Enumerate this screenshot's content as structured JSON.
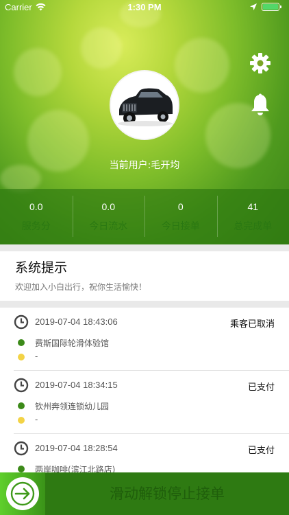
{
  "status_bar": {
    "carrier": "Carrier",
    "time": "1:30 PM"
  },
  "header": {
    "avatar_icon": "car-photo",
    "username": "当前用户:毛开均",
    "settings_icon": "gear-icon",
    "notifications_icon": "bell-icon"
  },
  "stats": [
    {
      "value": "0.0",
      "label": "服务分"
    },
    {
      "value": "0.0",
      "label": "今日流水"
    },
    {
      "value": "0",
      "label": "今日接单"
    },
    {
      "value": "41",
      "label": "总完成单"
    }
  ],
  "notice": {
    "title": "系统提示",
    "message": "欢迎加入小白出行，祝你生活愉快！"
  },
  "orders": [
    {
      "time": "2019-07-04 18:43:06",
      "status": "乘客已取消",
      "from": "费斯国际轮滑体验馆",
      "to": "-"
    },
    {
      "time": "2019-07-04 18:34:15",
      "status": "已支付",
      "from": "钦州奔领连锁幼儿园",
      "to": "-"
    },
    {
      "time": "2019-07-04 18:28:54",
      "status": "已支付",
      "from": "两岸咖啡(滨江北路店)",
      "to": ""
    }
  ],
  "slider": {
    "label": "滑动解锁停止接单",
    "icon": "arrow-right-icon"
  },
  "colors": {
    "primary_green": "#2e7a12",
    "start_dot": "#3c8a19",
    "end_dot": "#f3d346"
  }
}
